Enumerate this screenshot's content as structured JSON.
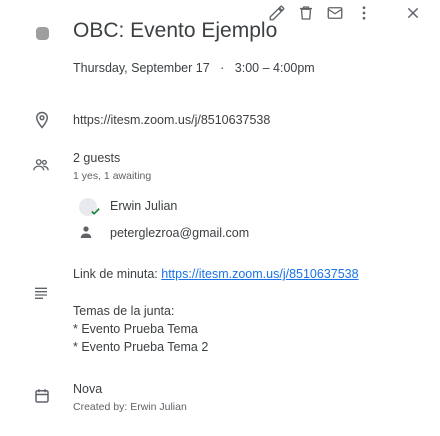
{
  "toolbar": {
    "edit_icon": "pencil-icon",
    "delete_icon": "trash-icon",
    "email_icon": "envelope-icon",
    "more_icon": "more-vert-icon",
    "close_icon": "close-icon"
  },
  "event": {
    "color": "#9e9e9e",
    "title": "OBC: Evento Ejemplo",
    "date": "Thursday, September 17",
    "separator": "·",
    "time": "3:00 – 4:00pm"
  },
  "location": {
    "icon": "location-pin-icon",
    "url": "https://itesm.zoom.us/j/8510637538"
  },
  "guests": {
    "icon": "people-icon",
    "count_label": "2 guests",
    "summary": "1 yes, 1 awaiting",
    "list": [
      {
        "name": "Erwin Julian",
        "status": "yes"
      },
      {
        "name": "peterglezroa@gmail.com",
        "status": "awaiting"
      }
    ]
  },
  "description": {
    "icon": "notes-icon",
    "minutes_label": "Link de minuta: ",
    "minutes_url": "https://itesm.zoom.us/j/8510637538",
    "agenda_title": "Temas de la junta:",
    "agenda_items": [
      "* Evento Prueba Tema",
      "* Evento Prueba Tema 2"
    ]
  },
  "calendar": {
    "icon": "calendar-icon",
    "name": "Nova",
    "created_by": "Created by: Erwin Julian"
  },
  "colors": {
    "icon_gray": "#5f6368",
    "text": "#3c4043",
    "link": "#1a73e8",
    "check_green": "#188038"
  }
}
